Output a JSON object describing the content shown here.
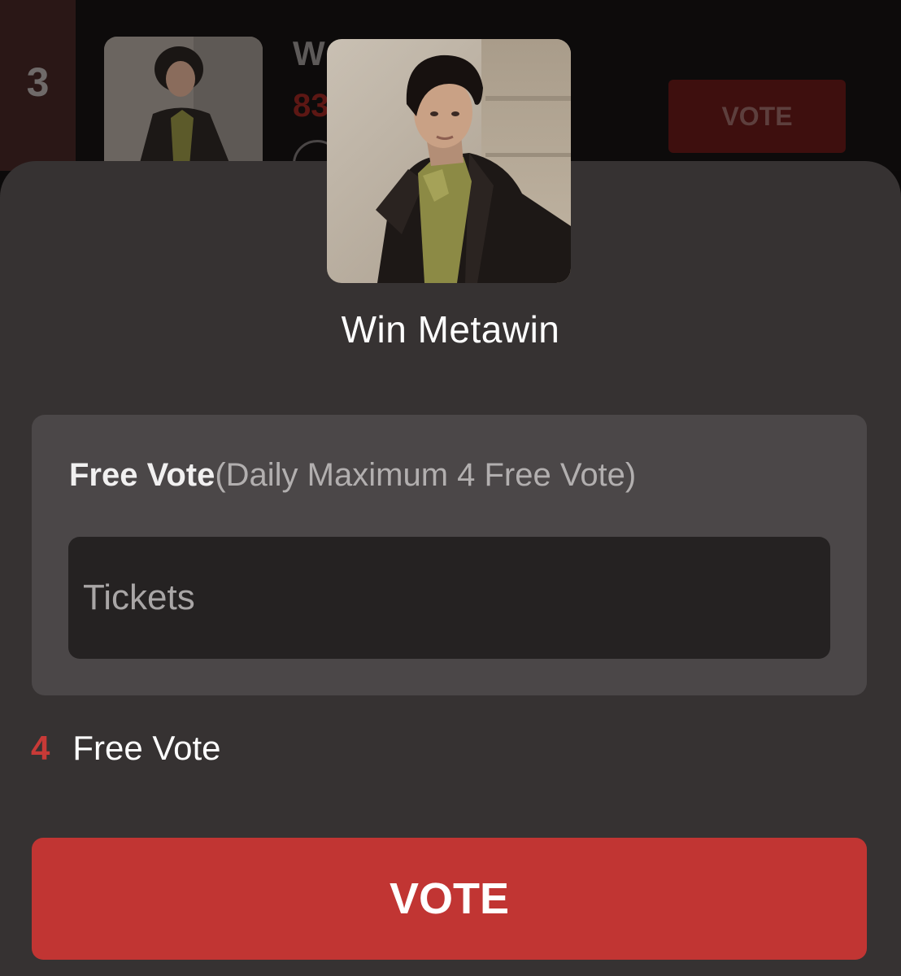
{
  "background_row": {
    "rank": "3",
    "name_partial": "W",
    "count_partial": "83",
    "vote_label": "VOTE"
  },
  "sheet": {
    "artist_name": "Win Metawin",
    "free_vote_title": "Free Vote",
    "free_vote_note": "(Daily Maximum 4 Free Vote)",
    "tickets_placeholder": "Tickets",
    "tickets_value": "",
    "free_vote_count": "4",
    "free_vote_count_label": "Free Vote",
    "vote_button_label": "VOTE"
  },
  "colors": {
    "accent_red": "#c13533",
    "count_red": "#c83a37",
    "sheet_bg": "#363232",
    "card_bg": "#4b4748",
    "input_bg": "#252222"
  },
  "icons": {
    "avatar": "artist-photo",
    "background_thumb": "artist-photo"
  }
}
